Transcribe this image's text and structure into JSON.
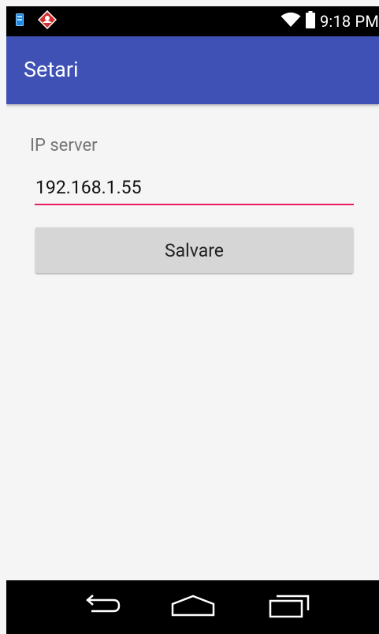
{
  "status_bar": {
    "time": "9:18 PM",
    "icons": [
      "sim-card-icon",
      "app-notification-icon",
      "wifi-icon",
      "battery-icon"
    ]
  },
  "app_bar": {
    "title": "Setari",
    "color": "#3F51B5"
  },
  "form": {
    "ip_label": "IP server",
    "ip_value": "192.168.1.55",
    "accent_color": "#E91E63",
    "save_label": "Salvare"
  },
  "nav_bar": {
    "buttons": [
      "back-icon",
      "home-icon",
      "recent-apps-icon"
    ]
  }
}
